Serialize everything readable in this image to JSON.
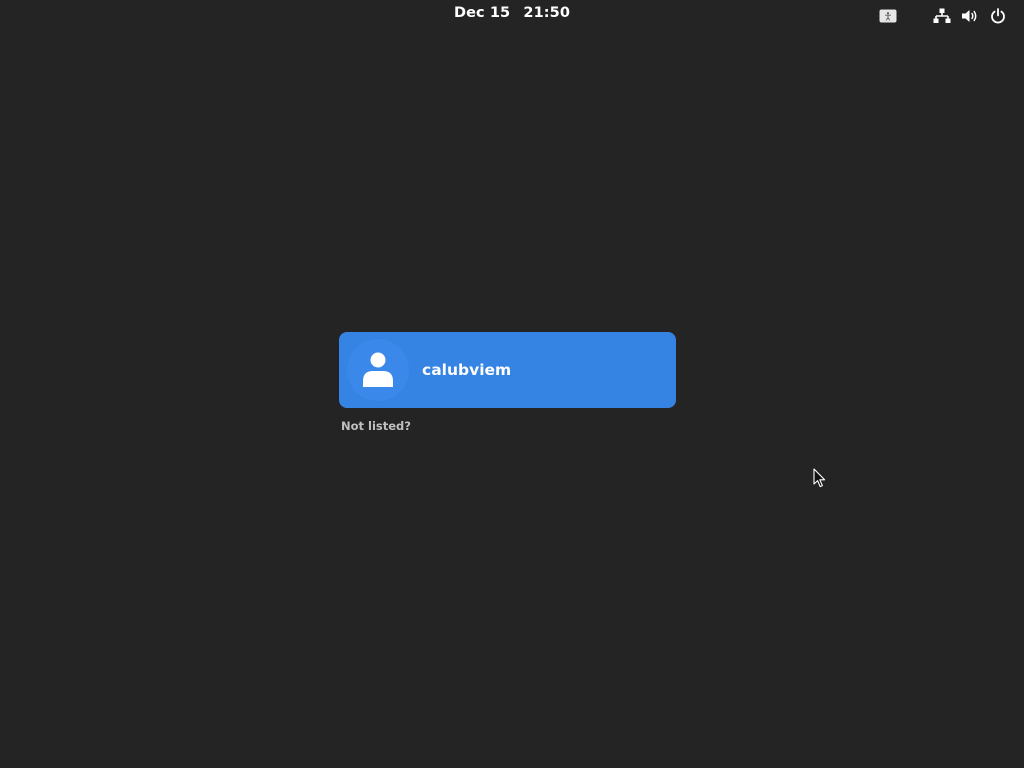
{
  "topbar": {
    "date": "Dec 15",
    "time": "21:50",
    "icons": [
      "accessibility-icon",
      "network-icon",
      "volume-icon",
      "power-icon"
    ]
  },
  "login": {
    "username": "calubviem",
    "not_listed_label": "Not listed?"
  },
  "colors": {
    "background": "#242424",
    "accent": "#3584e4",
    "text": "#ffffff",
    "muted_text": "#c0c0c0"
  }
}
